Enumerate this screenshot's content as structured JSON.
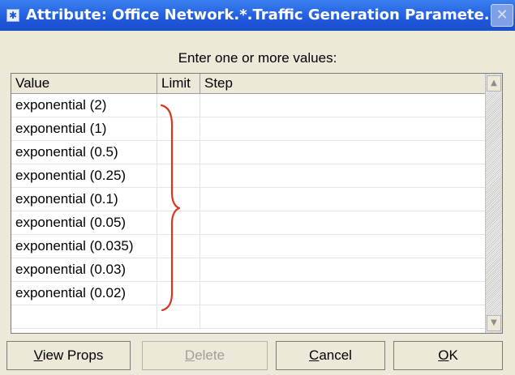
{
  "window": {
    "title": "Attribute: Office Network.*.Traffic Generation Paramete...",
    "icon": "asterisk-window-icon",
    "close_label": "✕"
  },
  "prompt": "Enter one or more values:",
  "table": {
    "columns": [
      "Value",
      "Limit",
      "Step"
    ],
    "rows": [
      {
        "value": "exponential (2)",
        "limit": "",
        "step": ""
      },
      {
        "value": "exponential (1)",
        "limit": "",
        "step": ""
      },
      {
        "value": "exponential (0.5)",
        "limit": "",
        "step": ""
      },
      {
        "value": "exponential (0.25)",
        "limit": "",
        "step": ""
      },
      {
        "value": "exponential (0.1)",
        "limit": "",
        "step": ""
      },
      {
        "value": "exponential (0.05)",
        "limit": "",
        "step": ""
      },
      {
        "value": "exponential (0.035)",
        "limit": "",
        "step": ""
      },
      {
        "value": "exponential (0.03)",
        "limit": "",
        "step": ""
      },
      {
        "value": "exponential (0.02)",
        "limit": "",
        "step": ""
      },
      {
        "value": "",
        "limit": "",
        "step": ""
      }
    ]
  },
  "annotation": {
    "brace_color": "#d9351f"
  },
  "buttons": {
    "view_props": {
      "mnemonic": "V",
      "rest": "iew Props"
    },
    "delete": {
      "mnemonic": "D",
      "rest": "elete",
      "enabled": false
    },
    "cancel": {
      "mnemonic": "C",
      "rest": "ancel"
    },
    "ok": {
      "mnemonic": "O",
      "rest": "K"
    }
  },
  "colors": {
    "titlebar": "#2968e3",
    "dialog_bg": "#ece9d8"
  }
}
